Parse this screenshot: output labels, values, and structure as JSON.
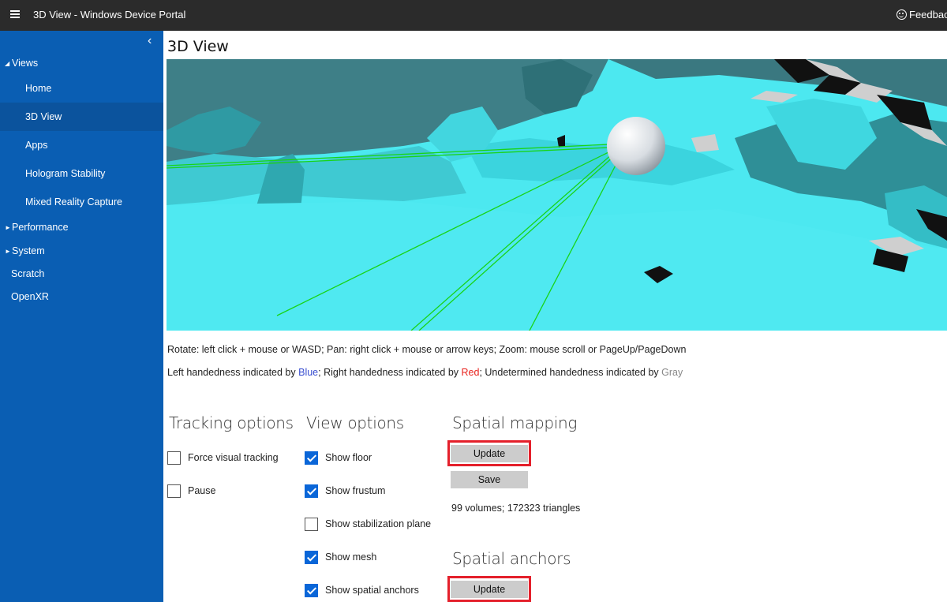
{
  "app": {
    "title": "3D View - Windows Device Portal",
    "feedback_label": "Feedback"
  },
  "sidebar": {
    "groups": {
      "views": "Views",
      "performance": "Performance",
      "system": "System",
      "scratch": "Scratch",
      "openxr": "OpenXR"
    },
    "items": [
      {
        "label": "Home"
      },
      {
        "label": "3D View"
      },
      {
        "label": "Apps"
      },
      {
        "label": "Hologram Stability"
      },
      {
        "label": "Mixed Reality Capture"
      }
    ]
  },
  "main": {
    "page_title": "3D View",
    "help": {
      "controls": "Rotate: left click + mouse or WASD; Pan: right click + mouse or arrow keys; Zoom: mouse scroll or PageUp/PageDown",
      "left_prefix": "Left handedness indicated by ",
      "left_color": "Blue",
      "right_prefix": "; Right handedness indicated by ",
      "right_color": "Red",
      "undetermined_prefix": "; Undetermined handedness indicated by ",
      "undetermined_color": "Gray"
    },
    "tracking_options": {
      "heading": "Tracking options",
      "options": [
        {
          "label": "Force visual tracking",
          "checked": false
        },
        {
          "label": "Pause",
          "checked": false
        }
      ]
    },
    "view_options": {
      "heading": "View options",
      "options": [
        {
          "label": "Show floor",
          "checked": true
        },
        {
          "label": "Show frustum",
          "checked": true
        },
        {
          "label": "Show stabilization plane",
          "checked": false
        },
        {
          "label": "Show mesh",
          "checked": true
        },
        {
          "label": "Show spatial anchors",
          "checked": true
        }
      ]
    },
    "spatial_mapping": {
      "heading": "Spatial mapping",
      "update_label": "Update",
      "save_label": "Save",
      "stats": "99 volumes; 172323 triangles"
    },
    "spatial_anchors": {
      "heading": "Spatial anchors",
      "update_label": "Update"
    }
  },
  "colors": {
    "sidebar_bg": "#0a5eb3",
    "topbar_bg": "#2b2b2b",
    "mesh": "#4ce8f0",
    "highlight": "#e4202b",
    "checkbox": "#0a66d8"
  }
}
